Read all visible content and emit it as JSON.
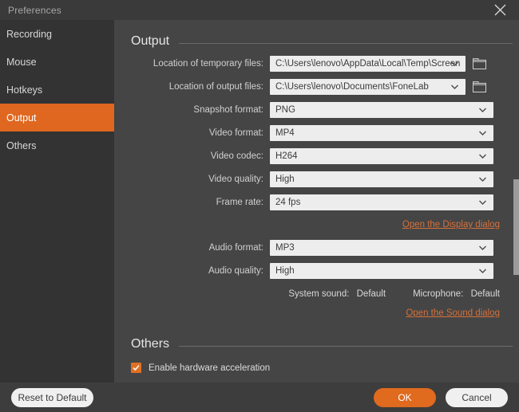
{
  "window": {
    "title": "Preferences",
    "close_icon": "close-icon"
  },
  "sidebar": {
    "items": [
      {
        "label": "Recording",
        "selected": false
      },
      {
        "label": "Mouse",
        "selected": false
      },
      {
        "label": "Hotkeys",
        "selected": false
      },
      {
        "label": "Output",
        "selected": true
      },
      {
        "label": "Others",
        "selected": false
      }
    ]
  },
  "sections": {
    "output": {
      "title": "Output",
      "fields": [
        {
          "label": "Location of temporary files:",
          "value": "C:\\Users\\lenovo\\AppData\\Local\\Temp\\Screen",
          "has_folder": true
        },
        {
          "label": "Location of output files:",
          "value": "C:\\Users\\lenovo\\Documents\\FoneLab",
          "has_folder": true
        },
        {
          "label": "Snapshot format:",
          "value": "PNG",
          "has_folder": false
        },
        {
          "label": "Video format:",
          "value": "MP4",
          "has_folder": false
        },
        {
          "label": "Video codec:",
          "value": "H264",
          "has_folder": false
        },
        {
          "label": "Video quality:",
          "value": "High",
          "has_folder": false
        },
        {
          "label": "Frame rate:",
          "value": "24 fps",
          "has_folder": false
        }
      ],
      "display_link": "Open the Display dialog",
      "audio_fields": [
        {
          "label": "Audio format:",
          "value": "MP3",
          "has_folder": false
        },
        {
          "label": "Audio quality:",
          "value": "High",
          "has_folder": false
        }
      ],
      "system_sound_label": "System sound:",
      "system_sound_value": "Default",
      "microphone_label": "Microphone:",
      "microphone_value": "Default",
      "sound_link": "Open the Sound dialog"
    },
    "others": {
      "title": "Others",
      "hardware_accel_label": "Enable hardware acceleration",
      "hardware_accel_checked": true
    }
  },
  "footer": {
    "reset_label": "Reset to Default",
    "ok_label": "OK",
    "cancel_label": "Cancel"
  },
  "colors": {
    "accent": "#df6720",
    "link": "#d5713a",
    "sidebar_bg": "#333333",
    "panel_bg": "#454545",
    "field_bg": "#ededed"
  }
}
